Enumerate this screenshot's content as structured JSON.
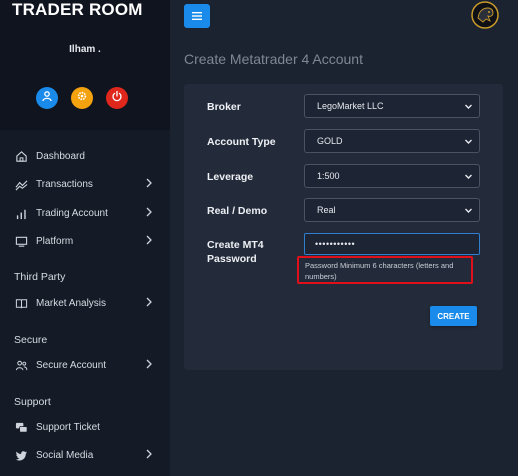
{
  "brand": "TRADER ROOM",
  "user": {
    "name": "Ilham ."
  },
  "nav": {
    "dashboard": "Dashboard",
    "transactions": "Transactions",
    "trading_account": "Trading Account",
    "platform": "Platform",
    "third_party_title": "Third Party",
    "market_analysis": "Market Analysis",
    "secure_title": "Secure",
    "secure_account": "Secure Account",
    "support_title": "Support",
    "support_ticket": "Support Ticket",
    "social_media": "Social Media"
  },
  "page": {
    "title": "Create Metatrader 4 Account"
  },
  "form": {
    "broker_label": "Broker",
    "broker_value": "LegoMarket LLC",
    "account_type_label": "Account Type",
    "account_type_value": "GOLD",
    "leverage_label": "Leverage",
    "leverage_value": "1:500",
    "real_demo_label": "Real / Demo",
    "real_demo_value": "Real",
    "password_label_line1": "Create MT4",
    "password_label_line2": "Password",
    "password_value": "•••••••••••",
    "password_hint": "Password Minimum 6 characters (letters and numbers)",
    "create_button": "CREATE"
  },
  "colors": {
    "accent": "#1a8bea",
    "orange": "#f5a20f",
    "red": "#e0271c",
    "hint_border": "#e0101a"
  },
  "icons": {
    "user": "user-icon",
    "settings": "gear-icon",
    "power": "power-icon",
    "menu": "hamburger-icon",
    "logo": "panther-logo"
  }
}
